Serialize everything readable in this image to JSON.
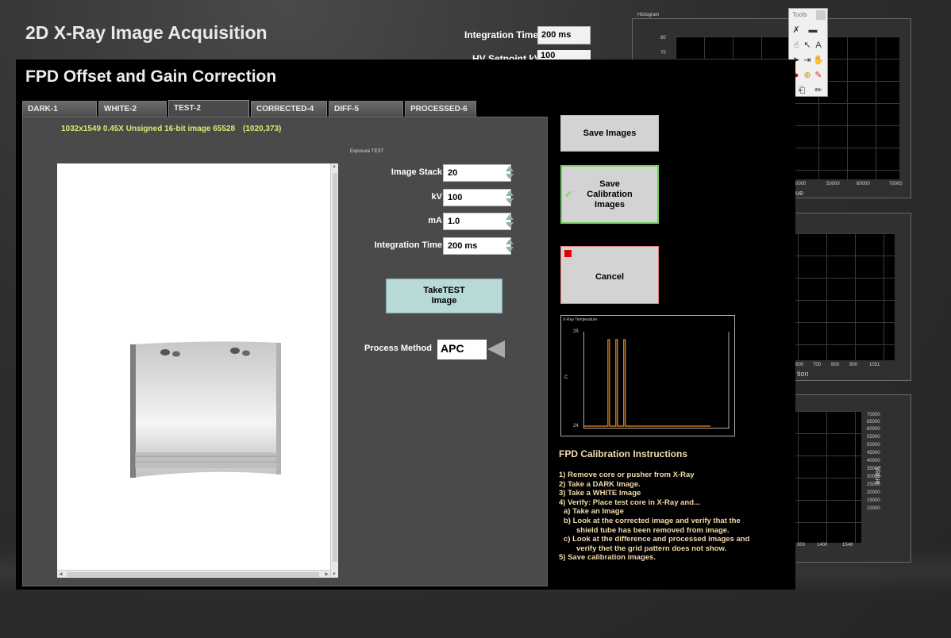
{
  "background_window": {
    "title": "2D X-Ray Image Acquisition",
    "integration_time_label": "Integration Time",
    "integration_time_value": "200 ms",
    "hv_setpoint_label": "HV Setpoint kV",
    "hv_setpoint_value": "100",
    "histogram": {
      "title": "Histogram",
      "y_ticks": [
        "80",
        "70"
      ],
      "x_ticks": [
        "0000",
        "50000",
        "60000",
        "70000"
      ],
      "x_label": "ue"
    },
    "profile_chart": {
      "x_ticks": [
        "600",
        "700",
        "800",
        "900",
        "1031"
      ],
      "x_label": "tion"
    },
    "column_chart": {
      "y_ticks": [
        "70000",
        "65000",
        "60000",
        "55000",
        "50000",
        "45000",
        "40000",
        "35000",
        "30000",
        "25000",
        "20000",
        "15000",
        "10000"
      ],
      "y_label": "Value",
      "x_ticks": [
        "300",
        "1400",
        "1548"
      ]
    },
    "tools_palette": {
      "title": "Tools",
      "tools": [
        "wrench-icon",
        "enable-toggle-icon",
        "hand-icon",
        "arrow-icon",
        "text-icon",
        "pointer-icon",
        "shortcut-icon",
        "grab-icon",
        "breakpoint-icon",
        "probe-icon",
        "color-picker-icon",
        "scroll-icon",
        "pencil-icon"
      ]
    }
  },
  "dialog": {
    "title": "FPD Offset and Gain Correction",
    "tabs": [
      {
        "label": "DARK-1",
        "active": false
      },
      {
        "label": "WHITE-2",
        "active": false
      },
      {
        "label": "TEST-2",
        "active": true
      },
      {
        "label": "CORRECTED-4",
        "active": false
      },
      {
        "label": "DIFF-5",
        "active": false
      },
      {
        "label": "PROCESSED-6",
        "active": false
      }
    ],
    "image_info": "1032x1549 0.45X Unsigned 16-bit image 65528",
    "image_coords": "(1020,373)",
    "exposure_caption": "Exposure TEST",
    "controls": [
      {
        "label": "Image Stack",
        "value": "20"
      },
      {
        "label": "kV",
        "value": "100"
      },
      {
        "label": "mA",
        "value": "1.0"
      },
      {
        "label": "Integration Time",
        "value": "200 ms"
      }
    ],
    "take_button_line1": "TakeTEST",
    "take_button_line2": "Image",
    "process_method_label": "Process Method",
    "process_method_value": "APC",
    "save_images_label": "Save Images",
    "save_calibration_line1": "Save",
    "save_calibration_line2": "Calibration",
    "save_calibration_line3": "Images",
    "cancel_label": "Cancel",
    "temperature_chart": {
      "title": "X-Ray Temperature",
      "y_label": "C",
      "y_max": "25",
      "y_min": "24"
    },
    "instructions": {
      "title": "FPD Calibration Instructions",
      "steps": [
        "1) Remove core or pusher from X-Ray",
        "2) Take a DARK Image.",
        "3) Take a WHITE Image",
        "4) Verify: Place test core in X-Ray and...",
        "a) Take an Image",
        "b)  Look at the corrected image and verify that the",
        "shield tube has been removed from image.",
        "c) Look at the difference and processed images and",
        "verify thet the grid pattern does not show.",
        "5) Save calibration images."
      ]
    }
  },
  "colors": {
    "info_text": "#d4ee70",
    "take_button": "#b7dad9",
    "instructions_text": "#f1d9a8",
    "temperature_trace": "#f08a1a",
    "cancel_stop": "#e00000",
    "save_calibration_border": "#6fcf5a"
  },
  "chart_data": {
    "type": "line",
    "title": "X-Ray Temperature",
    "ylabel": "C",
    "ylim": [
      24,
      25
    ],
    "series": [
      {
        "values": [
          24,
          25,
          24,
          25,
          24,
          25,
          24
        ]
      }
    ]
  }
}
